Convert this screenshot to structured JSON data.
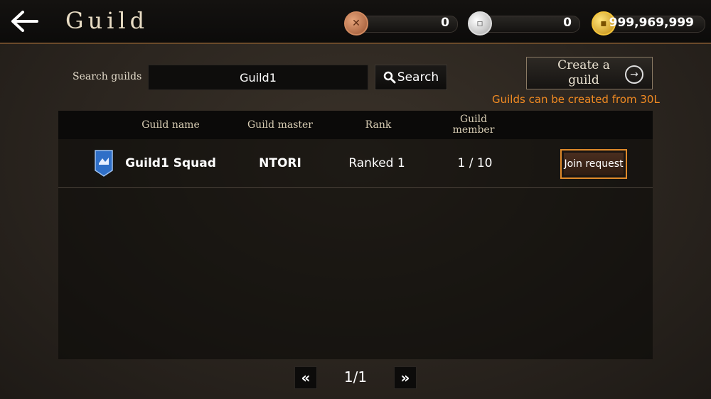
{
  "header": {
    "title": "Guild",
    "currencies": [
      {
        "name": "bronze-coin",
        "value": "0",
        "color": "#c2744a"
      },
      {
        "name": "silver-coin",
        "value": "0",
        "color": "#d9d9d9"
      },
      {
        "name": "gold-coin",
        "value": "999,969,999",
        "color": "#e6b325"
      }
    ]
  },
  "search": {
    "label": "Search guilds",
    "value": "Guild1",
    "button_label": "Search"
  },
  "create": {
    "label_line1": "Create a",
    "label_line2": "guild",
    "note": "Guilds can be created from 30L",
    "note_color": "#f08a22"
  },
  "table": {
    "headers": {
      "name": "Guild name",
      "master": "Guild master",
      "rank": "Rank",
      "member_line1": "Guild",
      "member_line2": "member"
    },
    "rows": [
      {
        "emblem": "blue-shield-emblem-icon",
        "name": "Guild1 Squad",
        "master": "NTORI",
        "rank": "Ranked 1",
        "members": "1 / 10",
        "action": "Join request"
      }
    ]
  },
  "pagination": {
    "indicator": "1/1",
    "prev_icon": "double-chevron-left-icon",
    "next_icon": "double-chevron-right-icon"
  }
}
